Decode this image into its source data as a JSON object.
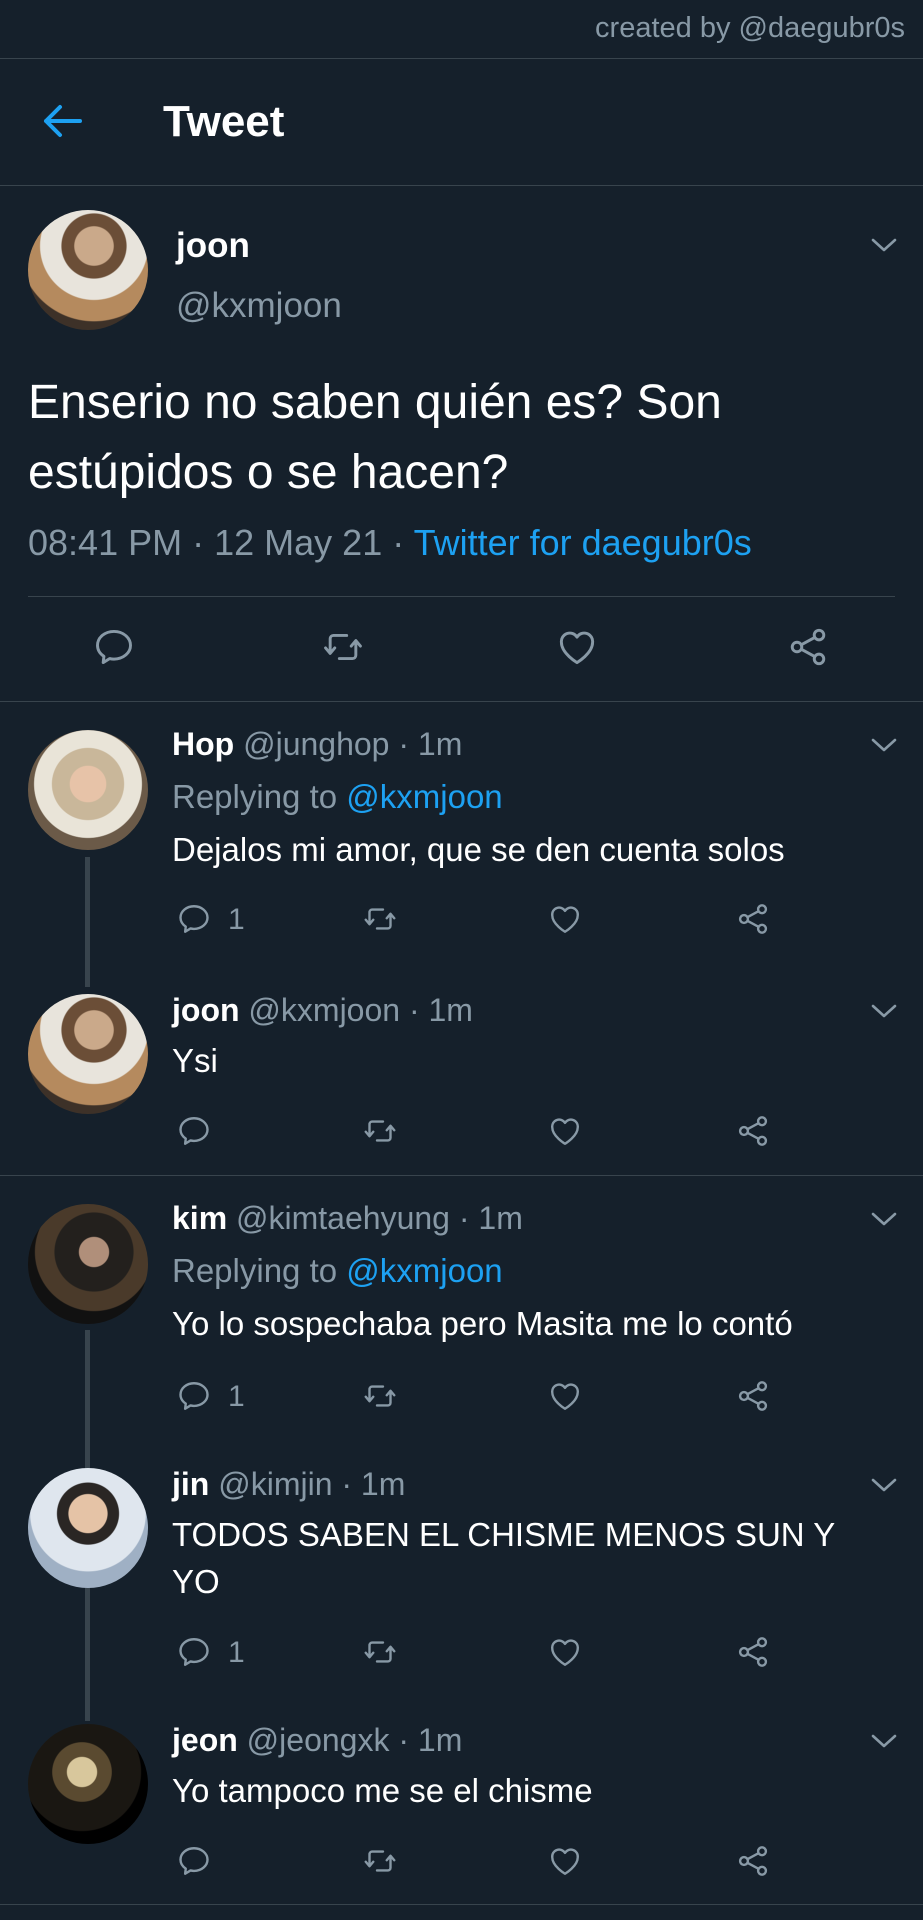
{
  "watermark": "created by @daegubr0s",
  "header": {
    "title": "Tweet"
  },
  "main_tweet": {
    "name": "joon",
    "handle": "@kxmjoon",
    "text": "Enserio no saben quién es? Son estúpidos o se hacen?",
    "time": "08:41 PM",
    "date": "12 May 21",
    "source": "Twitter for daegubr0s"
  },
  "replies": [
    {
      "name": "Hop",
      "handle": "@junghop",
      "time": "1m",
      "replying_label": "Replying to",
      "replying_to": "@kxmjoon",
      "text": "Dejalos mi amor, que se den cuenta solos",
      "reply_count": "1"
    },
    {
      "name": "joon",
      "handle": "@kxmjoon",
      "time": "1m",
      "text": "Ysi",
      "reply_count": ""
    },
    {
      "name": "kim",
      "handle": "@kimtaehyung",
      "time": "1m",
      "replying_label": "Replying to",
      "replying_to": "@kxmjoon",
      "text": "Yo lo sospechaba pero Masita me lo contó",
      "reply_count": "1"
    },
    {
      "name": "jin",
      "handle": "@kimjin",
      "time": "1m",
      "text": "TODOS SABEN EL CHISME MENOS SUN Y YO",
      "reply_count": "1"
    },
    {
      "name": "jeon",
      "handle": "@jeongxk",
      "time": "1m",
      "text": "Yo tampoco me se el chisme",
      "reply_count": ""
    }
  ],
  "colors": {
    "background": "#15202b",
    "accent": "#1da1f2",
    "muted": "#8899a6",
    "divider": "#38444d"
  },
  "icons": [
    "back-arrow-icon",
    "chevron-down-icon",
    "reply-icon",
    "retweet-icon",
    "like-icon",
    "share-icon"
  ]
}
